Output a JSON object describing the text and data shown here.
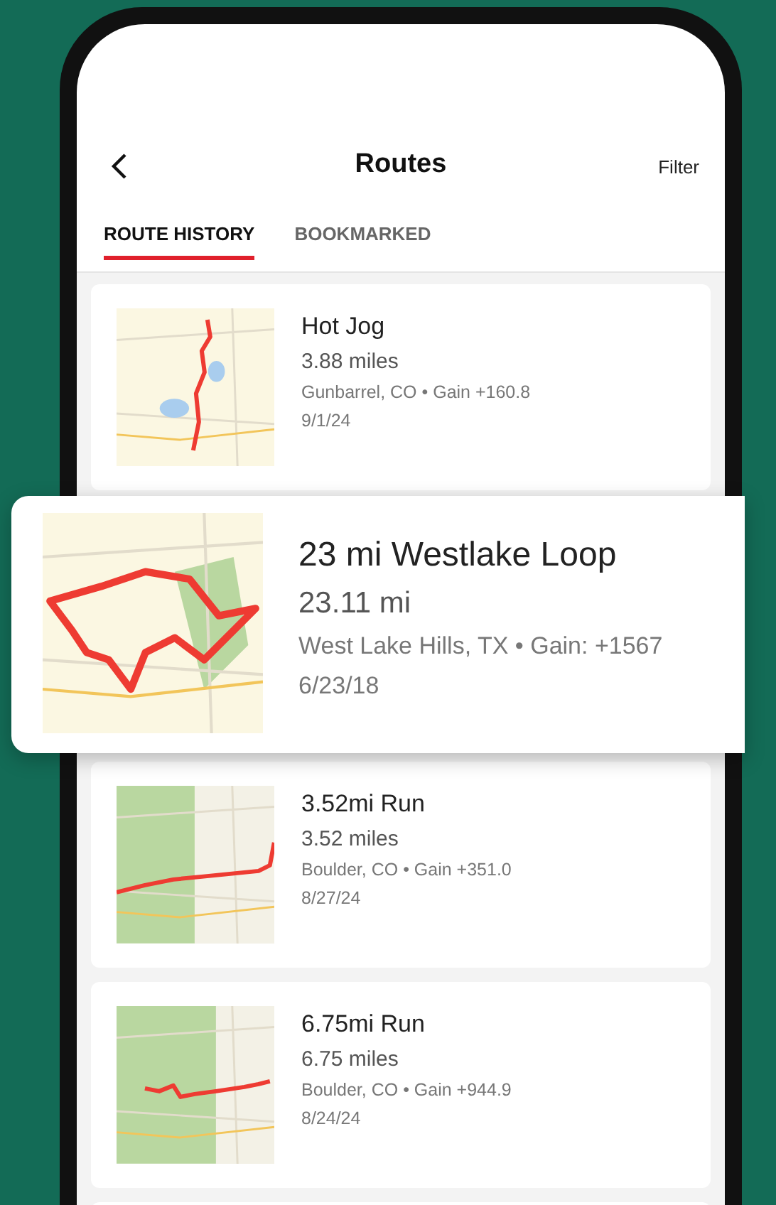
{
  "header": {
    "title": "Routes",
    "action": "Filter"
  },
  "tabs": [
    {
      "label": "ROUTE HISTORY",
      "selected": true
    },
    {
      "label": "BOOKMARKED",
      "selected": false
    }
  ],
  "routes": [
    {
      "kind": "card",
      "name": "Hot Jog",
      "distance": "3.88 miles",
      "meta": "Gunbarrel, CO • Gain +160.8",
      "date": "9/1/24"
    },
    {
      "kind": "highlight",
      "name": "23 mi Westlake Loop",
      "distance": "23.11 mi",
      "meta": "West Lake Hills, TX • Gain: +1567",
      "date": "6/23/18"
    },
    {
      "kind": "card",
      "name": "3.52mi Run",
      "distance": "3.52 miles",
      "meta": "Boulder, CO • Gain +351.0",
      "date": "8/27/24"
    },
    {
      "kind": "card",
      "name": "6.75mi Run",
      "distance": "6.75 miles",
      "meta": "Boulder, CO • Gain +944.9",
      "date": "8/24/24"
    }
  ]
}
